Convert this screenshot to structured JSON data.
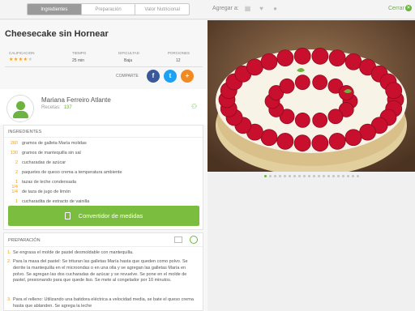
{
  "tabs": [
    {
      "label": "Ingredientes"
    },
    {
      "label": "Preparación"
    },
    {
      "label": "Valor Nutricional"
    }
  ],
  "toolbar": {
    "agregar_label": "Agregar a:",
    "cerrar_label": "Cerrar",
    "icons": [
      "calendar-icon",
      "heart-icon",
      "clock-icon",
      "close-icon"
    ]
  },
  "recipe": {
    "title": "Cheesecake sin Hornear",
    "stats": [
      {
        "label": "CALIFICACION",
        "value": ""
      },
      {
        "label": "TIEMPO",
        "value": "25 min"
      },
      {
        "label": "DIFICULTAD",
        "value": "Baja"
      },
      {
        "label": "PORCIONES",
        "value": "12"
      }
    ],
    "rating": 4,
    "comparte_label": "COMPARTE"
  },
  "author": {
    "name": "Mariana Ferreiro Atlante",
    "recipes_label": "Recetas:",
    "recipes_count": "137"
  },
  "ingredients": {
    "title": "INGREDIENTES",
    "items": [
      {
        "qty": "260",
        "text": "gramos de galleta María molidas"
      },
      {
        "qty": "130",
        "text": "gramos de mantequilla sin sal"
      },
      {
        "qty": "2",
        "text": "cucharadas de azúcar"
      },
      {
        "qty": "2",
        "text": "paquetes de queso crema a temperatura ambiente"
      },
      {
        "qty": "1 1/4",
        "text": "tazas de leche condensada"
      },
      {
        "qty": "1/4",
        "text": "de taza de jugo de limón"
      },
      {
        "qty": "1",
        "text": "cucharadita de extracto de vainilla"
      }
    ],
    "convert_label": "Convertidor de medidas"
  },
  "preparation": {
    "title": "PREPARACIÓN",
    "steps": [
      {
        "n": "1.",
        "text": "Se engrasa el molde de pastel desmoldable con mantequilla."
      },
      {
        "n": "2.",
        "text": "Para la masa del pastel: Se trituran las galletas María hasta que queden como polvo. Se derrite la mantequilla en el microondas o en una olla y se agregan las galletas María en polvo. Se agregan las dos cucharadas de azúcar y se revuelve. Se pone en el molde de pastel, presionando para que quede liso. Se mete al congelador por 10 minutos."
      },
      {
        "n": "3.",
        "text": "Para el relleno: Utilizando una batidora eléctrica a velocidad media, se bate el queso crema hasta que ablanden. Se agrega la leche"
      }
    ]
  },
  "gallery": {
    "count": 20,
    "active": 0
  },
  "colors": {
    "accent": "#6cb33f",
    "orange": "#f39c12",
    "facebook": "#3b5998",
    "twitter": "#1da1f2",
    "share": "#f08a24"
  }
}
